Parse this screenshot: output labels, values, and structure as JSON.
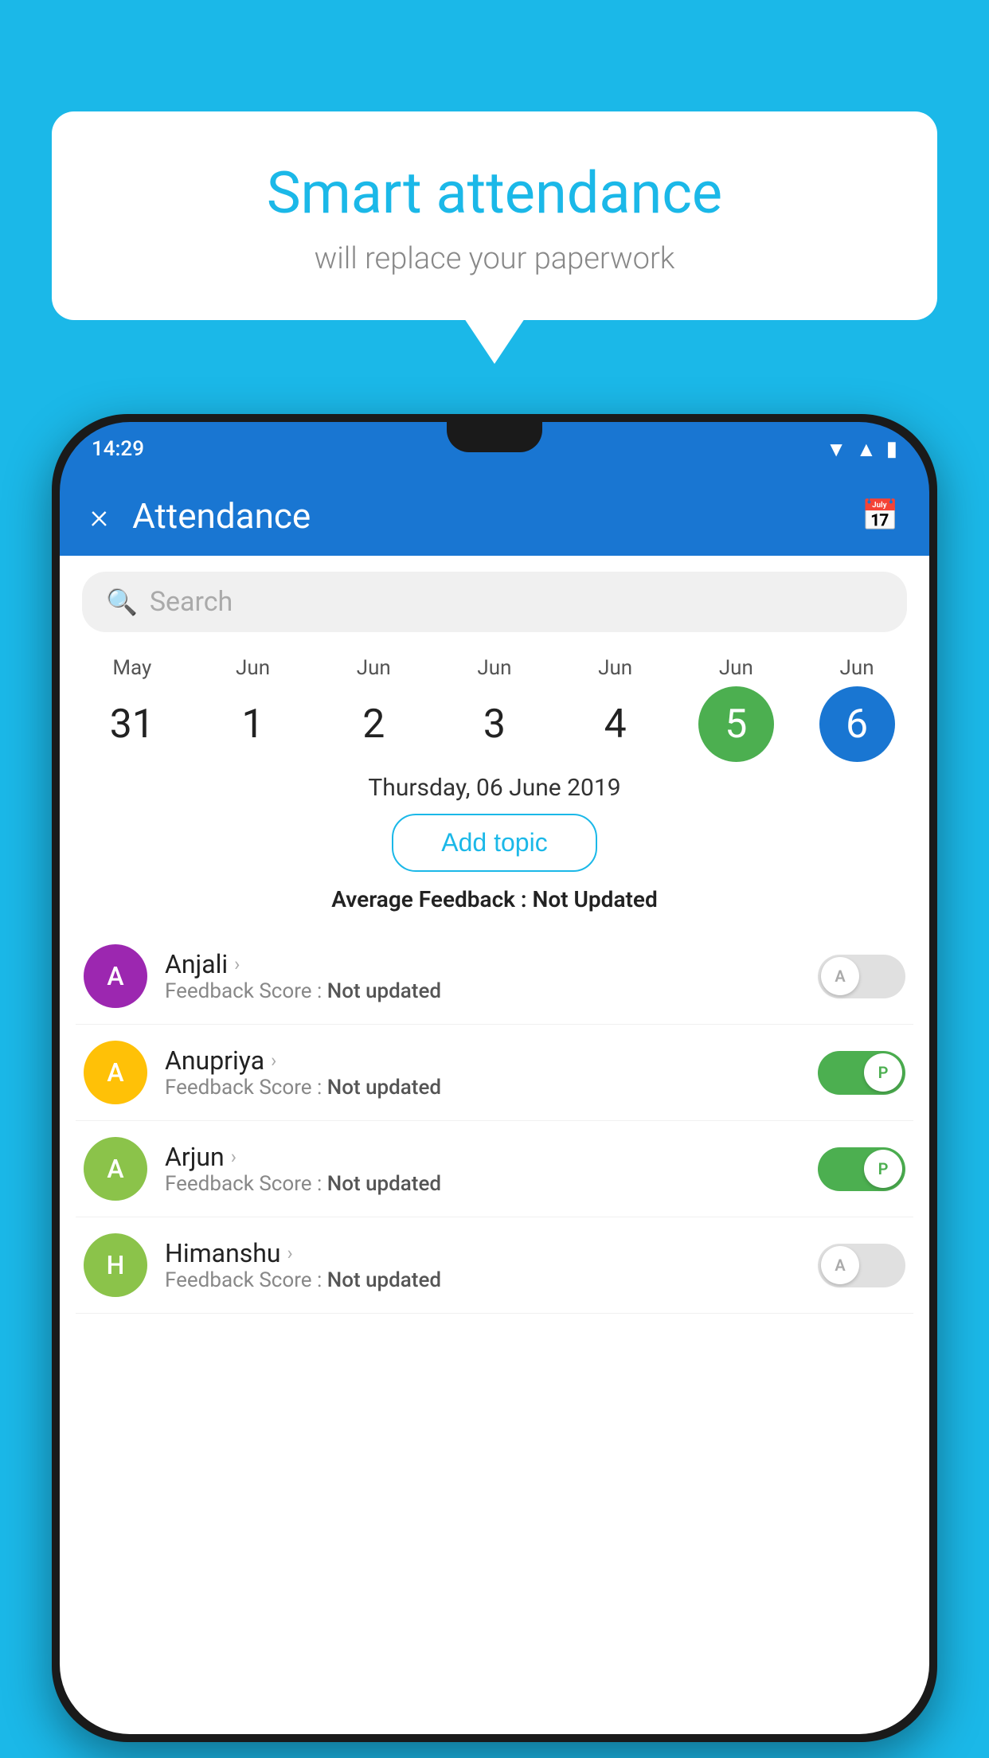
{
  "background_color": "#1BB8E8",
  "speech_bubble": {
    "headline": "Smart attendance",
    "subtext": "will replace your paperwork"
  },
  "status_bar": {
    "time": "14:29",
    "icons": [
      "wifi",
      "signal",
      "battery"
    ]
  },
  "app_bar": {
    "title": "Attendance",
    "close_label": "×",
    "calendar_icon": "📅"
  },
  "search": {
    "placeholder": "Search"
  },
  "calendar": {
    "days": [
      {
        "month": "May",
        "date": "31",
        "style": "normal"
      },
      {
        "month": "Jun",
        "date": "1",
        "style": "normal"
      },
      {
        "month": "Jun",
        "date": "2",
        "style": "normal"
      },
      {
        "month": "Jun",
        "date": "3",
        "style": "normal"
      },
      {
        "month": "Jun",
        "date": "4",
        "style": "normal"
      },
      {
        "month": "Jun",
        "date": "5",
        "style": "green"
      },
      {
        "month": "Jun",
        "date": "6",
        "style": "blue"
      }
    ]
  },
  "selected_date": "Thursday, 06 June 2019",
  "add_topic_label": "Add topic",
  "avg_feedback": {
    "label": "Average Feedback : ",
    "value": "Not Updated"
  },
  "students": [
    {
      "name": "Anjali",
      "initial": "A",
      "avatar_color": "#9C27B0",
      "feedback": "Not updated",
      "toggle": "off",
      "toggle_label": "A"
    },
    {
      "name": "Anupriya",
      "initial": "A",
      "avatar_color": "#FFC107",
      "feedback": "Not updated",
      "toggle": "on",
      "toggle_label": "P"
    },
    {
      "name": "Arjun",
      "initial": "A",
      "avatar_color": "#8BC34A",
      "feedback": "Not updated",
      "toggle": "on",
      "toggle_label": "P"
    },
    {
      "name": "Himanshu",
      "initial": "H",
      "avatar_color": "#8BC34A",
      "feedback": "Not updated",
      "toggle": "off",
      "toggle_label": "A"
    }
  ]
}
